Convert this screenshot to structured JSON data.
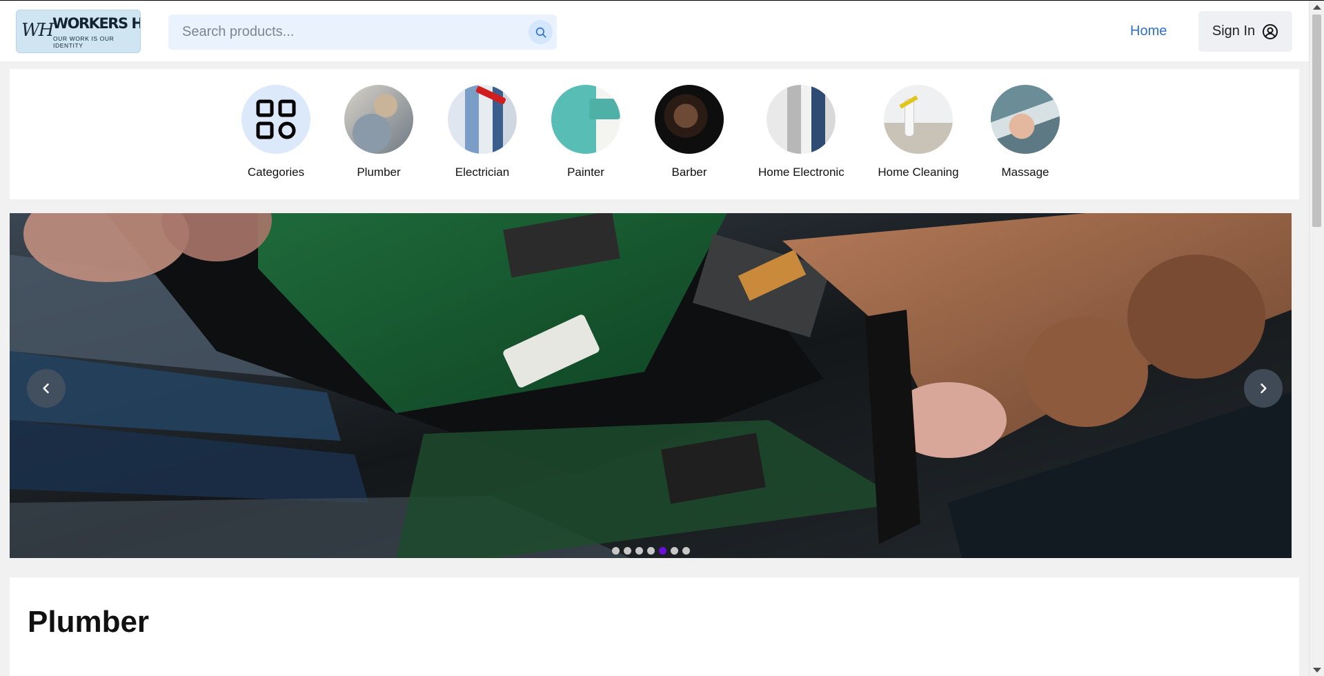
{
  "brand": {
    "mark": "WH",
    "name": "WORKERS HIVE",
    "tagline": "OUR WORK IS OUR IDENTITY"
  },
  "search": {
    "placeholder": "Search products..."
  },
  "nav": {
    "home_label": "Home",
    "signin_label": "Sign In"
  },
  "categories": [
    {
      "label": "Categories",
      "icon": "grid-icon"
    },
    {
      "label": "Plumber",
      "icon": "plumber-photo"
    },
    {
      "label": "Electrician",
      "icon": "electrician-photo"
    },
    {
      "label": "Painter",
      "icon": "painter-photo"
    },
    {
      "label": "Barber",
      "icon": "barber-photo"
    },
    {
      "label": "Home Electronics",
      "icon": "home-electronics-photo"
    },
    {
      "label": "Home Cleaning",
      "icon": "home-cleaning-photo"
    },
    {
      "label": "Massage",
      "icon": "massage-photo"
    }
  ],
  "carousel": {
    "slide_count": 7,
    "active_index": 4
  },
  "section": {
    "title": "Plumber"
  },
  "colors": {
    "accent_link": "#2f6fd0",
    "active_dot": "#6a0fd8",
    "search_bg": "#eaf3fd"
  }
}
